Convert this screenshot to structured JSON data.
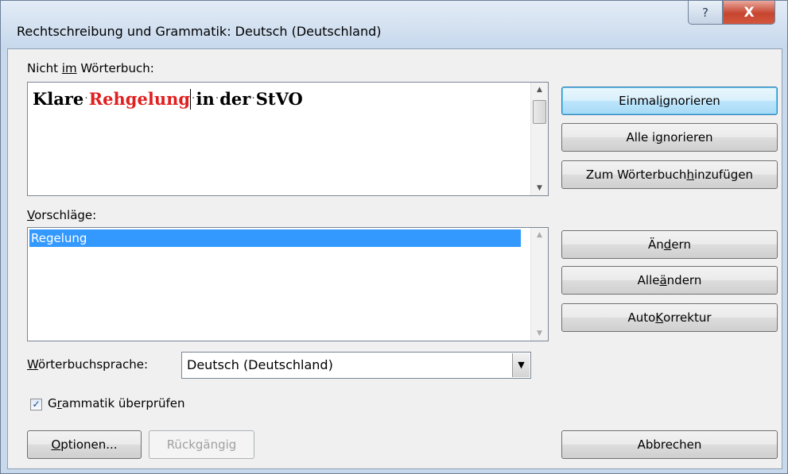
{
  "window": {
    "title": "Rechtschreibung und Grammatik: Deutsch (Deutschland)",
    "help_glyph": "?",
    "close_glyph": "X"
  },
  "not_in_dictionary": {
    "label_pre": "Nicht ",
    "label_accel": "im",
    "label_post": " Wörterbuch:",
    "words": [
      "Klare",
      "Rehgelung",
      "in",
      "der",
      "StVO"
    ],
    "error_word": "Rehgelung",
    "separator": "·"
  },
  "suggestions": {
    "label_accel": "V",
    "label_post": "orschläge:",
    "items": [
      "Regelung"
    ]
  },
  "buttons": {
    "ignore_once": {
      "pre": "Einmal ",
      "accel": "i",
      "post": "gnorieren"
    },
    "ignore_all": {
      "pre": "Alle i",
      "accel": "g",
      "post": "norieren"
    },
    "add_to_dictionary": {
      "pre": "Zum Wörterbuch ",
      "accel": "h",
      "post": "inzufügen"
    },
    "change": {
      "pre": "Än",
      "accel": "d",
      "post": "ern"
    },
    "change_all": {
      "pre": "Alle ",
      "accel": "ä",
      "post": "ndern"
    },
    "autocorrect": {
      "pre": "Auto",
      "accel": "K",
      "post": "orrektur"
    },
    "options": {
      "pre": "",
      "accel": "O",
      "post": "ptionen..."
    },
    "undo": {
      "label": "Rückgängig"
    },
    "cancel": {
      "label": "Abbrechen"
    }
  },
  "dictionary_language": {
    "label_accel": "W",
    "label_post": "örterbuchsprache:",
    "value": "Deutsch (Deutschland)"
  },
  "check_grammar": {
    "checked": true,
    "check_glyph": "✓",
    "label_pre": "G",
    "label_accel": "r",
    "label_post": "ammatik überprüfen"
  },
  "colors": {
    "error_text": "#e02020",
    "selection": "#3399ff"
  }
}
